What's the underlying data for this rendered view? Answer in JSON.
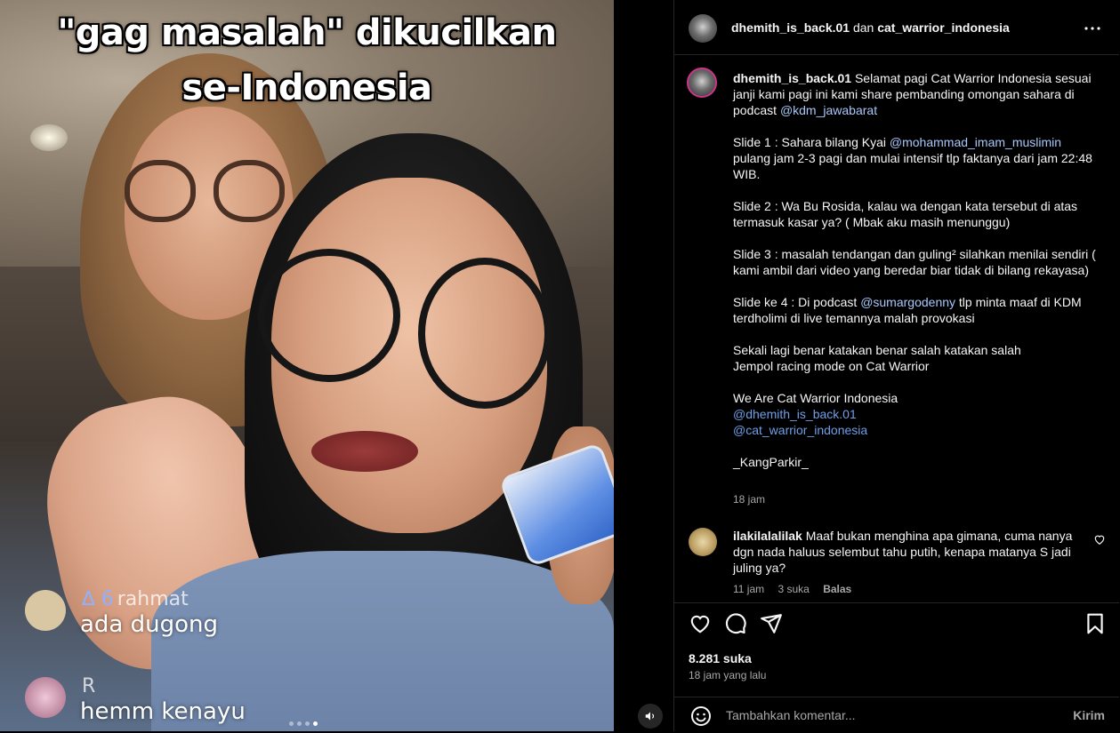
{
  "video": {
    "overlay_line1": "\"gag masalah\" dikucilkan",
    "overlay_line2": "se-Indonesia",
    "live_comments": [
      {
        "name": "rahmat",
        "badge": "∆ 6",
        "text": "ada dugong"
      },
      {
        "name": "R",
        "badge": "",
        "text": "hemm kenayu"
      }
    ],
    "carousel_dots": 4,
    "carousel_active": 3
  },
  "header": {
    "user1": "dhemith_is_back.01",
    "conjunction": "dan",
    "user2": "cat_warrior_indonesia",
    "more_icon": "more-horizontal-icon"
  },
  "caption": {
    "username": "dhemith_is_back.01",
    "intro": "Selamat pagi Cat Warrior Indonesia sesuai janji kami pagi ini kami share pembanding omongan sahara di podcast ",
    "intro_mention": "@kdm_jawabarat",
    "slide1_a": "Slide 1 : Sahara bilang Kyai ",
    "slide1_mention": "@mohammad_imam_muslimin",
    "slide1_b": " pulang jam 2-3 pagi dan mulai intensif tlp faktanya dari jam 22:48 WIB.",
    "slide2": "Slide 2 : Wa Bu Rosida, kalau wa dengan kata tersebut di atas termasuk kasar ya? ( Mbak aku masih menunggu)",
    "slide3": "Slide 3 : masalah tendangan dan guling² silahkan menilai sendiri ( kami ambil dari video yang beredar biar tidak di bilang rekayasa)",
    "slide4_a": "Slide ke 4 : Di podcast ",
    "slide4_mention": "@sumargodenny",
    "slide4_b": " tlp minta maaf di KDM terdholimi di live temannya malah provokasi",
    "closing1": "Sekali lagi benar katakan benar salah katakan salah",
    "closing2": "Jempol racing mode on Cat Warrior",
    "signoff": "We Are Cat Warrior Indonesia",
    "tag1": "@dhemith_is_back.01",
    "tag2": "@cat_warrior_indonesia",
    "author": "_KangParkir_",
    "time": "18 jam"
  },
  "comment": {
    "username": "ilakilalalilak",
    "text": "Maaf bukan menghina apa gimana, cuma nanya dgn nada haluus selembut tahu putih, kenapa matanya S jadi juling ya?",
    "time": "11 jam",
    "likes": "3 suka",
    "reply": "Balas"
  },
  "actions": {
    "likes": "8.281 suka",
    "posted": "18 jam yang lalu"
  },
  "comment_bar": {
    "placeholder": "Tambahkan komentar...",
    "post_label": "Kirim"
  },
  "colors": {
    "background": "#000000",
    "mention": "#a8c7fa",
    "muted": "#a8a8a8",
    "divider": "#262626"
  }
}
